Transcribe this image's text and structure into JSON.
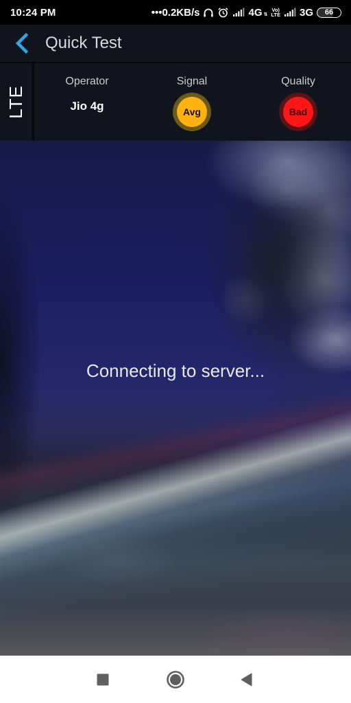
{
  "status_bar": {
    "time": "10:24 PM",
    "net_speed": "•••0.2KB/s",
    "icons": [
      "headset-icon",
      "alarm-icon",
      "signal-icon",
      "signal-icon"
    ],
    "sim1_network": "4G",
    "sim1_sub": "⇅",
    "volte_top": "Vo)",
    "volte_bottom": "LTE",
    "sim2_network": "3G",
    "battery_level": "66",
    "battery_fraction": 0.66
  },
  "app_bar": {
    "back_icon": "chevron-left-icon",
    "title": "Quick Test",
    "accent_color": "#2ea8e0"
  },
  "info_panel": {
    "tech_label": "LTE",
    "operator": {
      "label": "Operator",
      "value": "Jio 4g"
    },
    "signal": {
      "label": "Signal",
      "value": "Avg",
      "color": "#ffb20f"
    },
    "quality": {
      "label": "Quality",
      "value": "Bad",
      "color": "#ff1616"
    }
  },
  "content": {
    "message": "Connecting to server..."
  },
  "nav_bar": {
    "recents_icon": "square-icon",
    "home_icon": "circle-home-icon",
    "back_icon": "triangle-back-icon"
  }
}
